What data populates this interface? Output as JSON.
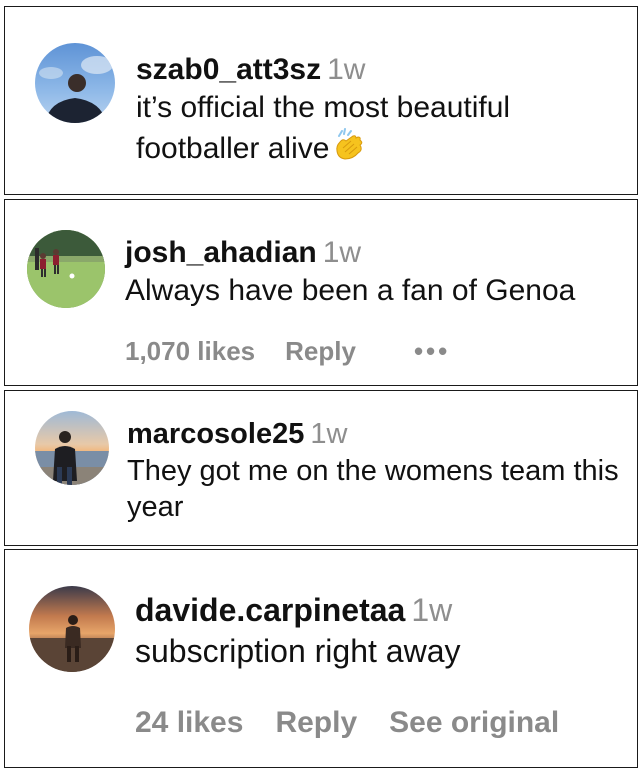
{
  "comments": [
    {
      "username": "szab0_att3sz",
      "time": "1w",
      "text": "it’s official the most beautiful footballer alive",
      "emoji": "clapping-hands-emoji"
    },
    {
      "username": "josh_ahadian",
      "time": "1w",
      "text": "Always have been a fan of Genoa",
      "likes": "1,070 likes",
      "reply": "Reply",
      "more": "•••"
    },
    {
      "username": "marcosole25",
      "time": "1w",
      "text": "They got me on the womens team this year"
    },
    {
      "username": "davide.carpinetaa",
      "time": "1w",
      "text": "subscription right away",
      "likes": "24 likes",
      "reply": "Reply",
      "see_original": "See original"
    }
  ],
  "colors": {
    "meta_gray": "#8e8e8e",
    "action_gray": "#8a8a8a",
    "text": "#111111",
    "border": "#1a1a1a"
  }
}
